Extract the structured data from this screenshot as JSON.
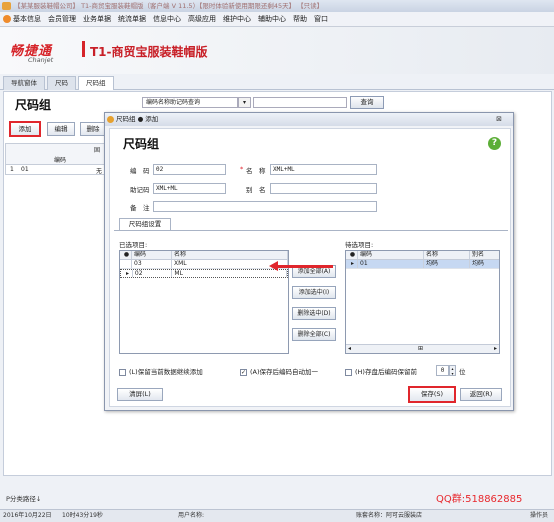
{
  "window_title": "【某某服装鞋帽公司】 T1-商贸宝服装鞋帽版（客户端 V 11.5）【限时体验新使用期限还剩45天】 【只读】",
  "menu": {
    "items": [
      "基本信息",
      "会员管理",
      "业务单据",
      "统流单据",
      "信息中心",
      "高级应用",
      "维护中心",
      "辅助中心",
      "帮助",
      "窗口"
    ]
  },
  "brand": {
    "logo": "畅捷通",
    "logo_en": "Chanjet",
    "product": "T1-商贸宝服装鞋帽版"
  },
  "tabs": [
    "导航窗体",
    "尺码",
    "尺码组"
  ],
  "page": {
    "title": "尺码组",
    "query_field": "编码名称助记码查询",
    "query_button": "查询",
    "toolbar": {
      "add": "添加",
      "edit": "编辑",
      "delete": "删除"
    },
    "grid": {
      "header_partial": "固",
      "col_code": "编码",
      "row_index": "1",
      "row_code": "01",
      "row_trail": "无"
    }
  },
  "dialog": {
    "title": "尺码组 ● 添加",
    "close": "⊠",
    "heading": "尺码组",
    "help": "?",
    "fields": {
      "code_label": "编　码",
      "code_value": "02",
      "name_req": "*",
      "name_label": "名　称",
      "name_value": "XML+ML",
      "mnemonic_label": "助记码",
      "mnemonic_value": "XML+ML",
      "alias_label": "别　名",
      "alias_value": "",
      "remark_label": "备　注",
      "remark_value": ""
    },
    "subtab": "尺码组设置",
    "selected": {
      "label": "已选项目:",
      "headers": [
        "编码",
        "名称"
      ],
      "rows": [
        {
          "code": "03",
          "name": "XML"
        },
        {
          "code": "02",
          "name": "ML"
        }
      ]
    },
    "pending": {
      "label": "待选项目:",
      "headers": [
        "编码",
        "名称",
        "别名"
      ],
      "rows": [
        {
          "code": "01",
          "name": "均码",
          "alias": "均码"
        }
      ],
      "scroll_mid": "⊞"
    },
    "middle_buttons": [
      "添加全部(A)",
      "添加选中(I)",
      "删除选中(D)",
      "删除全部(C)"
    ],
    "options": {
      "keep_data": "(L)保留当前数据继续添加",
      "auto_increment": "(A)保存后编码自动加一",
      "keep_digits": "(H)存盘后编码保留前",
      "digits_value": "0",
      "digits_unit": "位"
    },
    "buttons": {
      "clear": "清屏(L)",
      "save": "保存(S)",
      "back": "返回(R)"
    }
  },
  "footer": {
    "category_path": "P分类路径↓",
    "qq": "QQ群:518862885",
    "date": "2016年10月22日",
    "time": "10时43分19秒",
    "user_label": "用户名称:",
    "account": "账套名称：阿可云服装店",
    "operator": "操作员"
  },
  "colors": {
    "brand_red": "#d6242a",
    "highlight": "#e0262c",
    "help_green": "#5cae37"
  }
}
